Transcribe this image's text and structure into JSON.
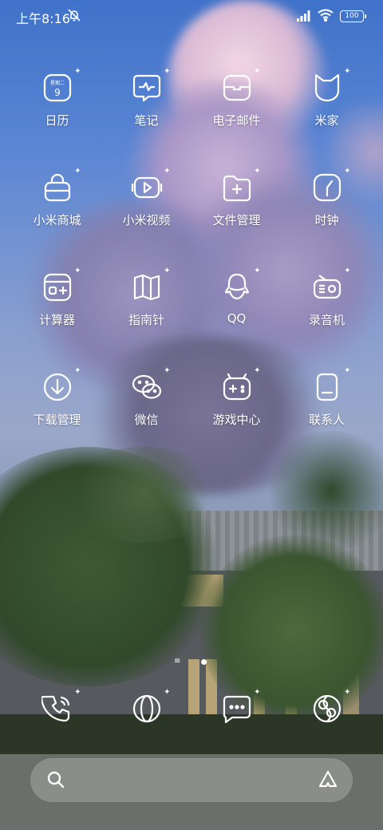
{
  "status_bar": {
    "time": "上午8:16",
    "battery": "100"
  },
  "apps": [
    {
      "label": "日历",
      "icon": "calendar-icon",
      "calendar_weekday": "星期二",
      "calendar_day": "9"
    },
    {
      "label": "笔记",
      "icon": "notes-icon"
    },
    {
      "label": "电子邮件",
      "icon": "email-icon"
    },
    {
      "label": "米家",
      "icon": "mijia-icon"
    },
    {
      "label": "小米商城",
      "icon": "shopping-bag-icon"
    },
    {
      "label": "小米视频",
      "icon": "video-icon"
    },
    {
      "label": "文件管理",
      "icon": "folder-icon"
    },
    {
      "label": "时钟",
      "icon": "clock-icon"
    },
    {
      "label": "计算器",
      "icon": "calculator-icon"
    },
    {
      "label": "指南针",
      "icon": "map-icon"
    },
    {
      "label": "QQ",
      "icon": "qq-icon"
    },
    {
      "label": "录音机",
      "icon": "recorder-icon"
    },
    {
      "label": "下载管理",
      "icon": "download-icon"
    },
    {
      "label": "微信",
      "icon": "wechat-icon"
    },
    {
      "label": "游戏中心",
      "icon": "game-icon"
    },
    {
      "label": "联系人",
      "icon": "contacts-icon"
    }
  ],
  "dock": [
    {
      "icon": "phone-icon"
    },
    {
      "icon": "browser-icon"
    },
    {
      "icon": "messages-icon"
    },
    {
      "icon": "gallery-icon"
    }
  ],
  "search_bar": {
    "left_icon": "search-icon",
    "right_icon": "assistant-icon"
  }
}
